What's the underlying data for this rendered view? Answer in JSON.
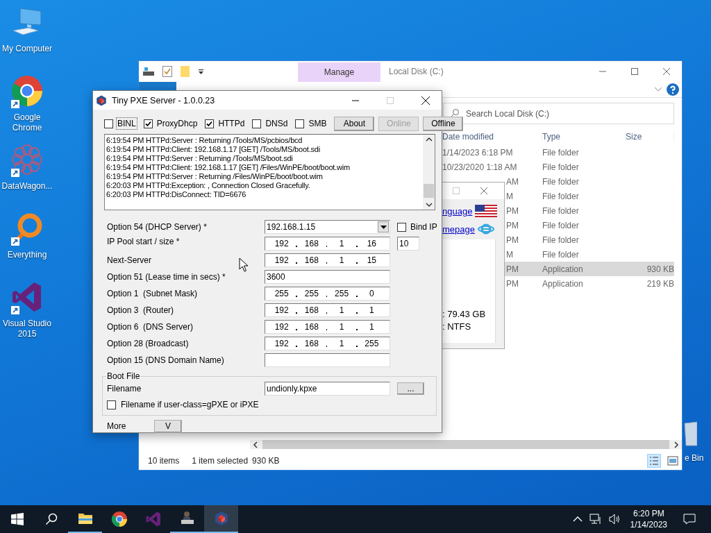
{
  "desktop": {
    "icons": [
      {
        "label": "My Computer",
        "kind": "computer",
        "shortcut": false
      },
      {
        "label": "Google Chrome",
        "kind": "browser",
        "shortcut": true
      },
      {
        "label": "DataWagon...",
        "kind": "datawagon",
        "shortcut": true
      },
      {
        "label": "Everything",
        "kind": "finder",
        "shortcut": true
      },
      {
        "label": "Visual Studio 2015",
        "kind": "studio",
        "shortcut": true
      }
    ],
    "recycle_bin_label": "e Bin"
  },
  "explorer": {
    "title": "Local Disk (C:)",
    "contextual_tab": "Manage",
    "search": {
      "placeholder": "Search Local Disk (C:)"
    },
    "columns": [
      "Date modified",
      "Type",
      "Size"
    ],
    "rows": [
      {
        "date": "1/14/2023 6:18 PM",
        "type": "File folder",
        "selected": false
      },
      {
        "date": "10/23/2020 1:18 AM",
        "type": "File folder",
        "selected": false
      },
      {
        "date": "AM",
        "type": "File folder",
        "selected": false
      },
      {
        "date": "M",
        "type": "File folder",
        "selected": false
      },
      {
        "date": "PM",
        "type": "File folder",
        "selected": false
      },
      {
        "date": "PM",
        "type": "File folder",
        "selected": false
      },
      {
        "date": "PM",
        "type": "File folder",
        "selected": false
      },
      {
        "date": "M",
        "type": "File folder",
        "selected": false
      },
      {
        "date": "PM",
        "type": "Application",
        "size": "930 KB",
        "selected": true
      },
      {
        "date": "PM",
        "type": "Application",
        "size": "219 KB",
        "selected": false
      }
    ],
    "status": {
      "count": "10 items",
      "selection": "1 item selected",
      "selection_size": "930 KB"
    }
  },
  "properties_dialog": {
    "links": [
      {
        "label": "nguage",
        "kind": "flag"
      },
      {
        "label": "mepage",
        "kind": "browser"
      }
    ],
    "details": [
      ": 79.43 GB",
      ": NTFS"
    ]
  },
  "pxe": {
    "title": "Tiny PXE Server - 1.0.0.23",
    "services": [
      {
        "label": "BINL",
        "checked": false,
        "focused": true
      },
      {
        "label": "ProxyDhcp",
        "checked": true,
        "focused": false
      },
      {
        "label": "HTTPd",
        "checked": true,
        "focused": false
      },
      {
        "label": "DNSd",
        "checked": false,
        "focused": false
      },
      {
        "label": "SMB",
        "checked": false,
        "focused": false
      }
    ],
    "buttons": [
      {
        "label": "About",
        "disabled": false
      },
      {
        "label": "Online",
        "disabled": true
      },
      {
        "label": "Offline",
        "disabled": false
      }
    ],
    "log": [
      "6:19:54 PM HTTPd:Server : Returning /Tools/MS/pcbios/bcd",
      "6:19:54 PM HTTPd:Client: 192.168.1.17 [GET] /Tools/MS/boot.sdi",
      "6:19:54 PM HTTPd:Server : Returning /Tools/MS/boot.sdi",
      "6:19:54 PM HTTPd:Client: 192.168.1.17 [GET] /Files/WinPE/boot/boot.wim",
      "6:19:54 PM HTTPd:Server : Returning /Files/WinPE/boot/boot.wim",
      "6:20:03 PM HTTPd:Exception: , Connection Closed Gracefully.",
      "6:20:03 PM HTTPd:DisConnect: TID=6676"
    ],
    "fields": [
      {
        "label": "Option 54 (DHCP Server) *",
        "kind": "dropdown",
        "value": "192.168.1.15"
      },
      {
        "label": "IP Pool start / size *",
        "kind": "ip",
        "octets": [
          "192",
          "168",
          "1",
          "16"
        ]
      },
      {
        "label": "Next-Server",
        "kind": "ip",
        "octets": [
          "192",
          "168",
          "1",
          "15"
        ]
      },
      {
        "label": "Option 51 (Lease time in secs) *",
        "kind": "text",
        "value": "3600"
      },
      {
        "label": "Option 1  (Subnet Mask)",
        "kind": "ip",
        "octets": [
          "255",
          "255",
          "255",
          "0"
        ]
      },
      {
        "label": "Option 3  (Router)",
        "kind": "ip",
        "octets": [
          "192",
          "168",
          "1",
          "1"
        ]
      },
      {
        "label": "Option 6  (DNS Server)",
        "kind": "ip",
        "octets": [
          "192",
          "168",
          "1",
          "1"
        ]
      },
      {
        "label": "Option 28 (Broadcast)",
        "kind": "ip",
        "octets": [
          "192",
          "168",
          "1",
          "255"
        ]
      },
      {
        "label": "Option 15 (DNS Domain Name)",
        "kind": "text"
      }
    ],
    "bind_ip": {
      "label": "Bind IP",
      "checked": false
    },
    "pool_size": "10",
    "boot_file": {
      "legend": "Boot File",
      "label": "Filename",
      "value": "undionly.kpxe",
      "browse": "...",
      "user_class": {
        "label": "Filename if user-class=gPXE or iPXE",
        "checked": false
      }
    },
    "more": {
      "label": "More",
      "button": "V"
    }
  },
  "taskbar": {
    "apps": [
      {
        "kind": "explorer",
        "running": true,
        "active": false
      },
      {
        "kind": "browser",
        "running": false,
        "active": false
      },
      {
        "kind": "studio",
        "running": false,
        "active": false
      },
      {
        "kind": "tool",
        "running": true,
        "active": false
      },
      {
        "kind": "pxe",
        "running": true,
        "active": true
      }
    ],
    "time": "6:20 PM",
    "date": "1/14/2023"
  }
}
